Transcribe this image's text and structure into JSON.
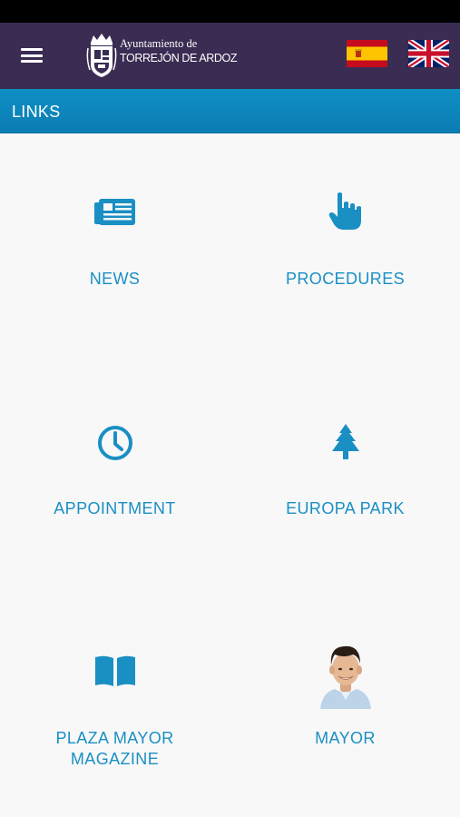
{
  "header": {
    "logo_line1": "Ayuntamiento de",
    "logo_line2": "TORREJÓN DE ARDOZ",
    "menu_icon": "hamburger-menu-icon",
    "flags": [
      "spain-flag-icon",
      "uk-flag-icon"
    ]
  },
  "section": {
    "title": "LINKS"
  },
  "links": [
    {
      "label": "NEWS",
      "icon": "newspaper-icon"
    },
    {
      "label": "PROCEDURES",
      "icon": "pointing-hand-icon"
    },
    {
      "label": "APPOINTMENT",
      "icon": "clock-icon"
    },
    {
      "label": "EUROPA PARK",
      "icon": "tree-icon"
    },
    {
      "label_line1": "PLAZA MAYOR",
      "label_line2": "MAGAZINE",
      "icon": "book-icon"
    },
    {
      "label": "MAYOR",
      "icon": "mayor-portrait"
    }
  ],
  "colors": {
    "header_bg": "#3a2c52",
    "section_bg": "#0f8fc4",
    "accent": "#1a8fc3",
    "page_bg": "#f8f8f9"
  }
}
